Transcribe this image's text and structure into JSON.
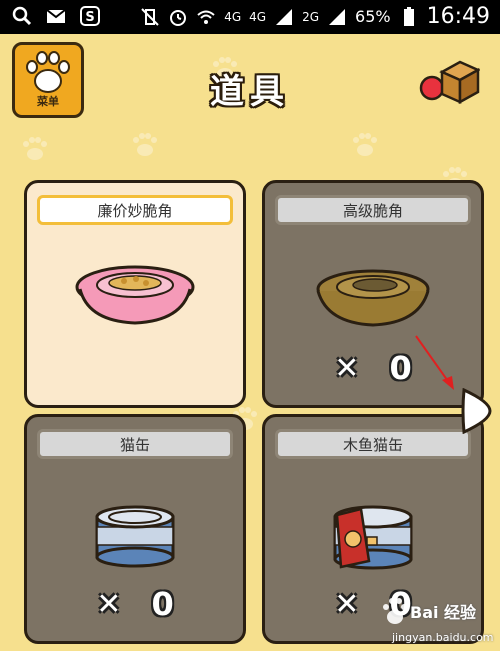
{
  "status_bar": {
    "left_icons": [
      "search-icon",
      "mail-icon",
      "s-app-icon"
    ],
    "network_4g": "4G",
    "signal_4g": "4G",
    "signal_2g": "2G",
    "battery_percent": "65%",
    "time": "16:49"
  },
  "header": {
    "title": "道具",
    "menu_label": "菜单"
  },
  "items": [
    {
      "label": "廉价妙脆角",
      "times": "",
      "quantity": ""
    },
    {
      "label": "高级脆角",
      "times": "✕",
      "quantity": "0"
    },
    {
      "label": "猫缶",
      "times": "✕",
      "quantity": "0"
    },
    {
      "label": "木鱼猫缶",
      "times": "✕",
      "quantity": "0"
    }
  ],
  "watermark": {
    "main": "Bai 经验",
    "url": "jingyan.baidu.com"
  }
}
